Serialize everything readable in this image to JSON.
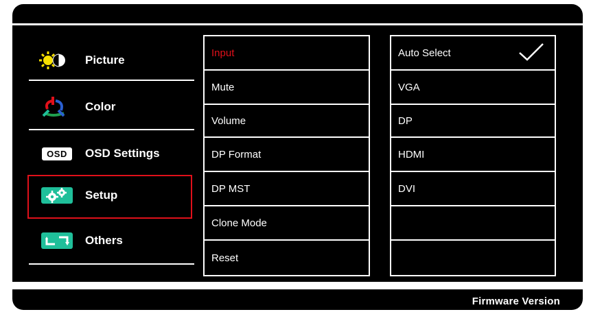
{
  "left_menu": {
    "items": [
      {
        "label": "Picture",
        "icon": "brightness-contrast-icon"
      },
      {
        "label": "Color",
        "icon": "rgb-color-icon"
      },
      {
        "label": "OSD Settings",
        "icon": "osd-icon",
        "badge": "OSD"
      },
      {
        "label": "Setup",
        "icon": "gears-icon",
        "selected": true
      },
      {
        "label": "Others",
        "icon": "arrows-icon"
      }
    ]
  },
  "middle_menu": {
    "items": [
      {
        "label": "Input",
        "active": true
      },
      {
        "label": "Mute"
      },
      {
        "label": "Volume"
      },
      {
        "label": "DP Format"
      },
      {
        "label": "DP MST"
      },
      {
        "label": "Clone Mode"
      },
      {
        "label": "Reset"
      }
    ]
  },
  "right_menu": {
    "items": [
      {
        "label": "Auto Select",
        "checked": true
      },
      {
        "label": "VGA"
      },
      {
        "label": "DP"
      },
      {
        "label": "HDMI"
      },
      {
        "label": "DVI"
      },
      {
        "label": ""
      },
      {
        "label": ""
      }
    ]
  },
  "footer": {
    "firmware_label": "Firmware Version"
  },
  "colors": {
    "background": "#000000",
    "text": "#ffffff",
    "active": "#e0101a",
    "accent_teal": "#1fbf9a"
  }
}
